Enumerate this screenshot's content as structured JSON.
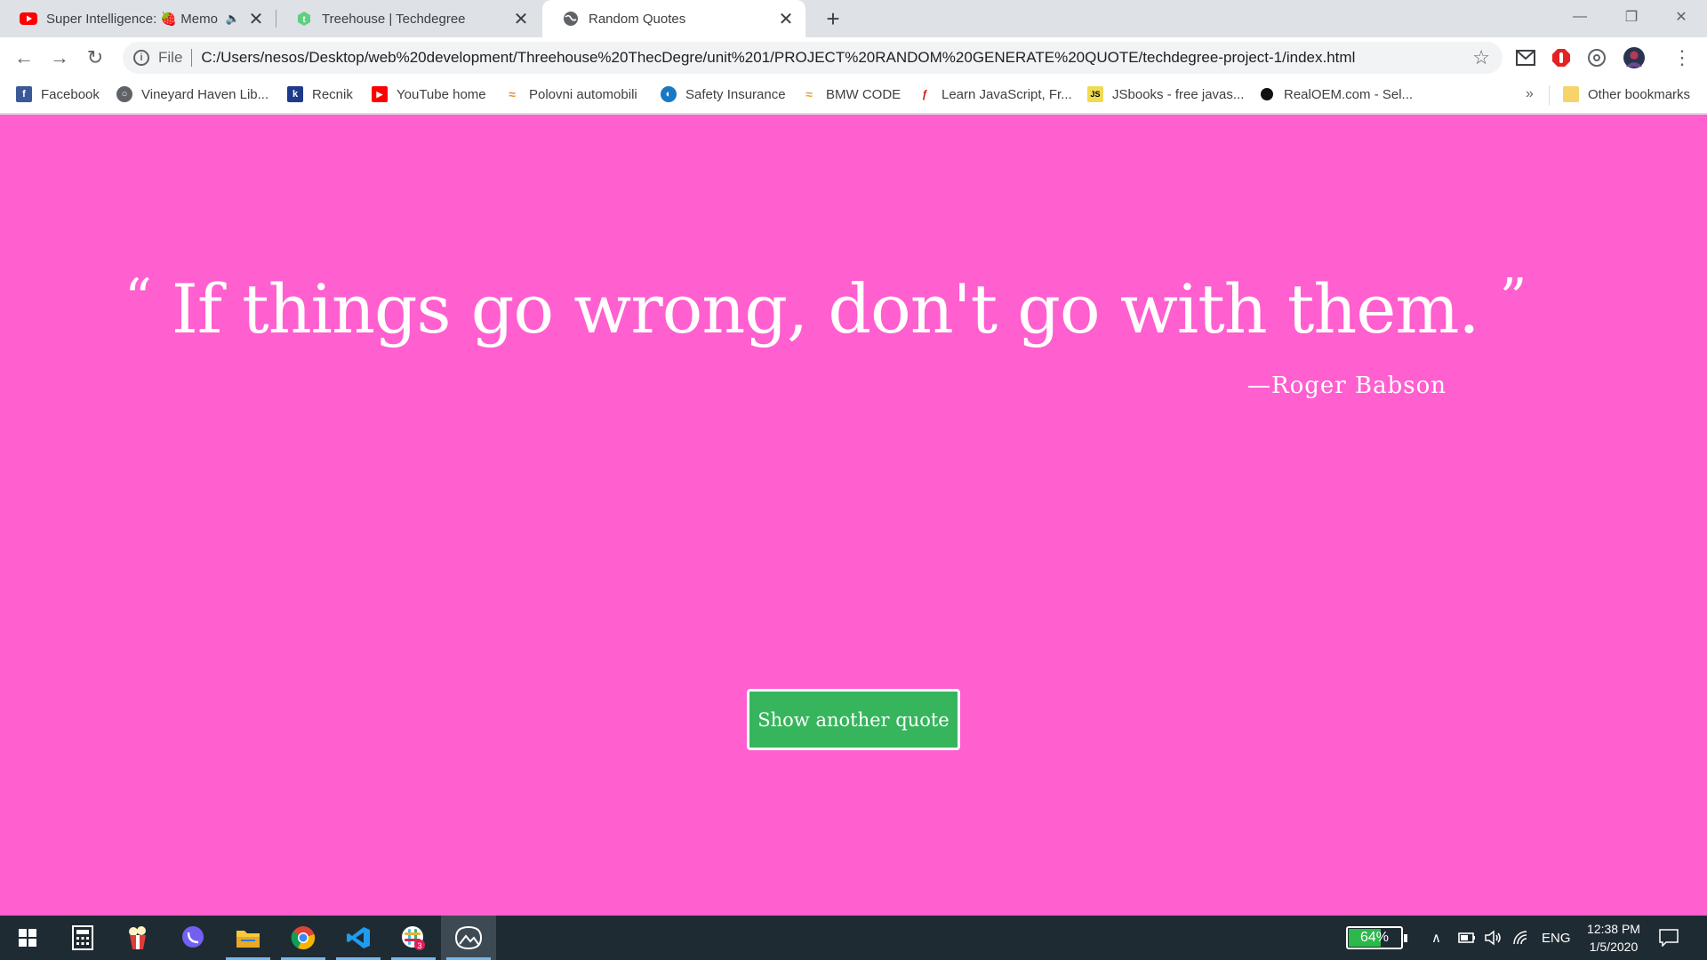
{
  "browser": {
    "tabs": [
      {
        "title": "Super Intelligence: 🍓 Memo",
        "favicon": "youtube-icon",
        "audio": true
      },
      {
        "title": "Treehouse | Techdegree",
        "favicon": "treehouse-icon"
      },
      {
        "title": "Random Quotes",
        "favicon": "globe-icon",
        "active": true
      }
    ],
    "address": {
      "scheme": "File",
      "url": "C:/Users/nesos/Desktop/web%20development/Threehouse%20ThecDegre/unit%201/PROJECT%20RANDOM%20GENERATE%20QUOTE/techdegree-project-1/index.html"
    },
    "bookmarks": [
      {
        "label": "Facebook",
        "icon": "facebook-icon"
      },
      {
        "label": "Vineyard Haven Lib...",
        "icon": "globe-icon"
      },
      {
        "label": "Recnik",
        "icon": "k-icon"
      },
      {
        "label": "YouTube home",
        "icon": "youtube-icon"
      },
      {
        "label": "Polovni automobili",
        "icon": "car-icon"
      },
      {
        "label": "Safety Insurance",
        "icon": "globe-icon"
      },
      {
        "label": "BMW CODE",
        "icon": "car-icon"
      },
      {
        "label": "Learn JavaScript, Fr...",
        "icon": "learn-icon"
      },
      {
        "label": "JSbooks - free javas...",
        "icon": "js-icon"
      },
      {
        "label": "RealOEM.com - Sel...",
        "icon": "bmw-icon"
      }
    ],
    "more_bookmarks": "»",
    "other_bookmarks": "Other bookmarks"
  },
  "page": {
    "open_quote": "“",
    "quote": "If things go wrong, don't go with them.",
    "close_quote": "”",
    "source": "—Roger Babson",
    "button": "Show another quote",
    "background_color": "#ff5fcf",
    "button_color": "#36b55c"
  },
  "taskbar": {
    "battery": "64%",
    "battery_level": 0.64,
    "language": "ENG",
    "time": "12:38 PM",
    "date": "1/5/2020",
    "slack_badge": "3"
  }
}
